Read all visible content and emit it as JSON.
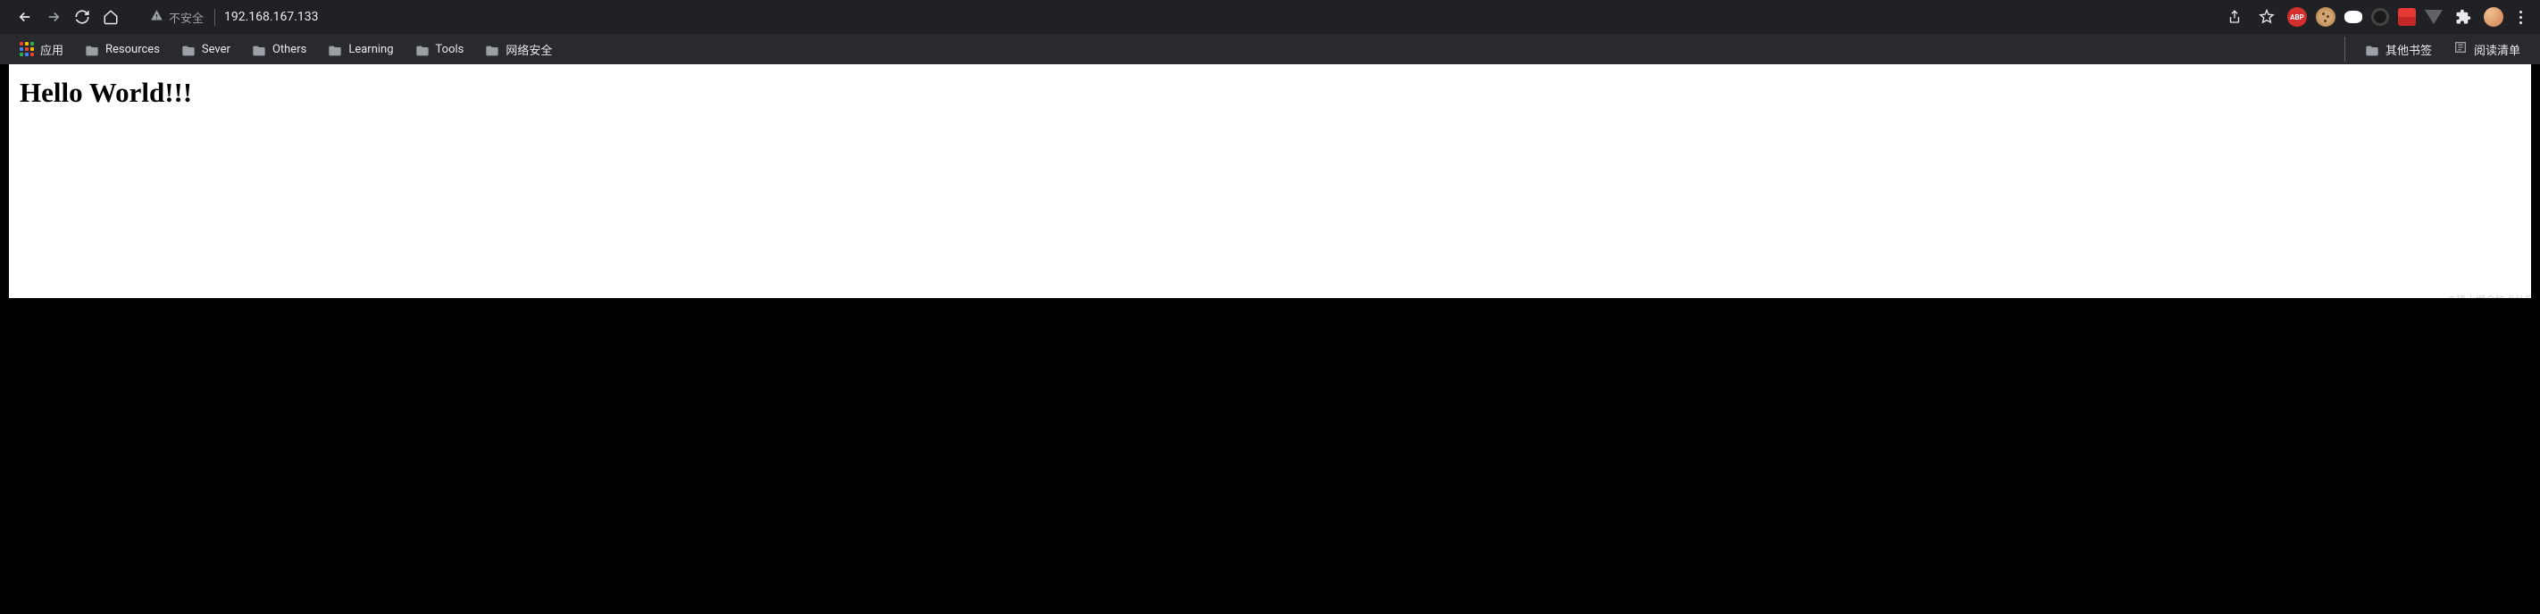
{
  "toolbar": {
    "security_label": "不安全",
    "url": "192.168.167.133"
  },
  "extensions": {
    "abp_label": "ABP"
  },
  "bookmarks": {
    "apps_label": "应用",
    "items": [
      {
        "label": "Resources"
      },
      {
        "label": "Sever"
      },
      {
        "label": "Others"
      },
      {
        "label": "Learning"
      },
      {
        "label": "Tools"
      },
      {
        "label": "网络安全"
      }
    ],
    "other_bookmarks": "其他书签",
    "reading_list": "阅读清单"
  },
  "page": {
    "heading": "Hello World!!!"
  },
  "watermark": "@稀土掘金技术社区"
}
